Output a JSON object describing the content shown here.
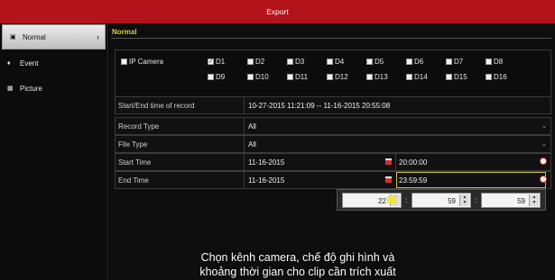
{
  "window": {
    "title": "Export"
  },
  "sidebar": {
    "items": [
      {
        "label": "Normal",
        "icon": "camera-icon",
        "active": true
      },
      {
        "label": "Event",
        "icon": "bell-icon",
        "active": false
      },
      {
        "label": "Picture",
        "icon": "picture-icon",
        "active": false
      }
    ]
  },
  "tab": {
    "label": "Normal"
  },
  "channels": {
    "ip_camera_label": "IP Camera",
    "ip_camera_checked": false,
    "row1": [
      {
        "label": "D1",
        "checked": true
      },
      {
        "label": "D2",
        "checked": false
      },
      {
        "label": "D3",
        "checked": false
      },
      {
        "label": "D4",
        "checked": false
      },
      {
        "label": "D5",
        "checked": false
      },
      {
        "label": "D6",
        "checked": false
      },
      {
        "label": "D7",
        "checked": false
      },
      {
        "label": "D8",
        "checked": false
      }
    ],
    "row2": [
      {
        "label": "D9",
        "checked": false
      },
      {
        "label": "D10",
        "checked": false
      },
      {
        "label": "D11",
        "checked": false
      },
      {
        "label": "D12",
        "checked": false
      },
      {
        "label": "D13",
        "checked": false
      },
      {
        "label": "D14",
        "checked": false
      },
      {
        "label": "D15",
        "checked": false
      },
      {
        "label": "D16",
        "checked": false
      }
    ]
  },
  "form": {
    "range_label": "Start/End time of record",
    "range_value": "10-27-2015 11:21:09 -- 11-16-2015 20:55:08",
    "record_type_label": "Record Type",
    "record_type_value": "All",
    "file_type_label": "File Type",
    "file_type_value": "All",
    "start_time_label": "Start Time",
    "start_date": "11-16-2015",
    "start_time": "20:00:00",
    "end_time_label": "End Time",
    "end_date": "11-16-2015",
    "end_time": "23:59:59"
  },
  "time_spinner": {
    "hours": "22",
    "minutes": "59",
    "seconds": "59",
    "separator": ":"
  },
  "caption": {
    "line1": "Chọn kênh camera, chế độ ghi hình và",
    "line2": "khoảng thời gian cho clip cần trích xuất"
  },
  "colors": {
    "title_bar": "#b3141b",
    "tab_accent": "#d4cf3a",
    "highlight_border": "#c8c24a"
  }
}
